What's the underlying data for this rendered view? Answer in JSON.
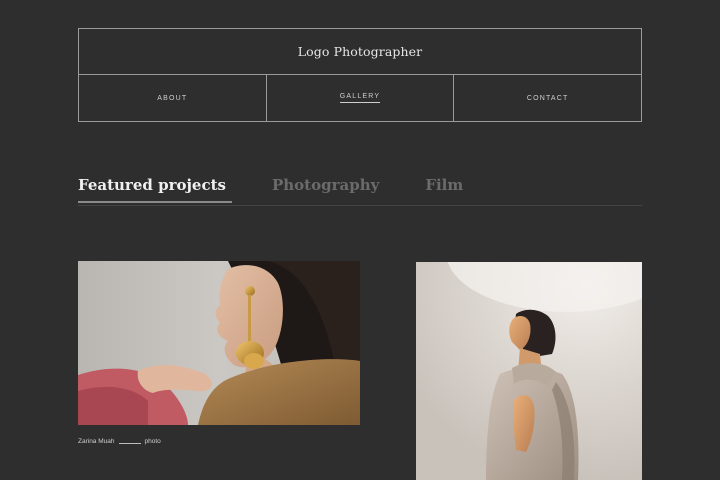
{
  "header": {
    "logo": "Logo Photographer",
    "nav": [
      {
        "label": "ABOUT",
        "active": false
      },
      {
        "label": "GALLERY",
        "active": true
      },
      {
        "label": "CONTACT",
        "active": false
      }
    ]
  },
  "tabs": [
    {
      "label": "Featured projects",
      "active": true
    },
    {
      "label": "Photography",
      "active": false
    },
    {
      "label": "Film",
      "active": false
    }
  ],
  "projects": [
    {
      "caption_name": "Zarina Muah",
      "caption_type": "photo",
      "image": "portrait-woman-gold-earring"
    },
    {
      "image": "portrait-woman-beige-vest"
    }
  ],
  "colors": {
    "background": "#2e2e2e",
    "border": "#9a9a9a",
    "text_active": "#f0f0f0",
    "text_inactive": "#6b6b6b"
  }
}
